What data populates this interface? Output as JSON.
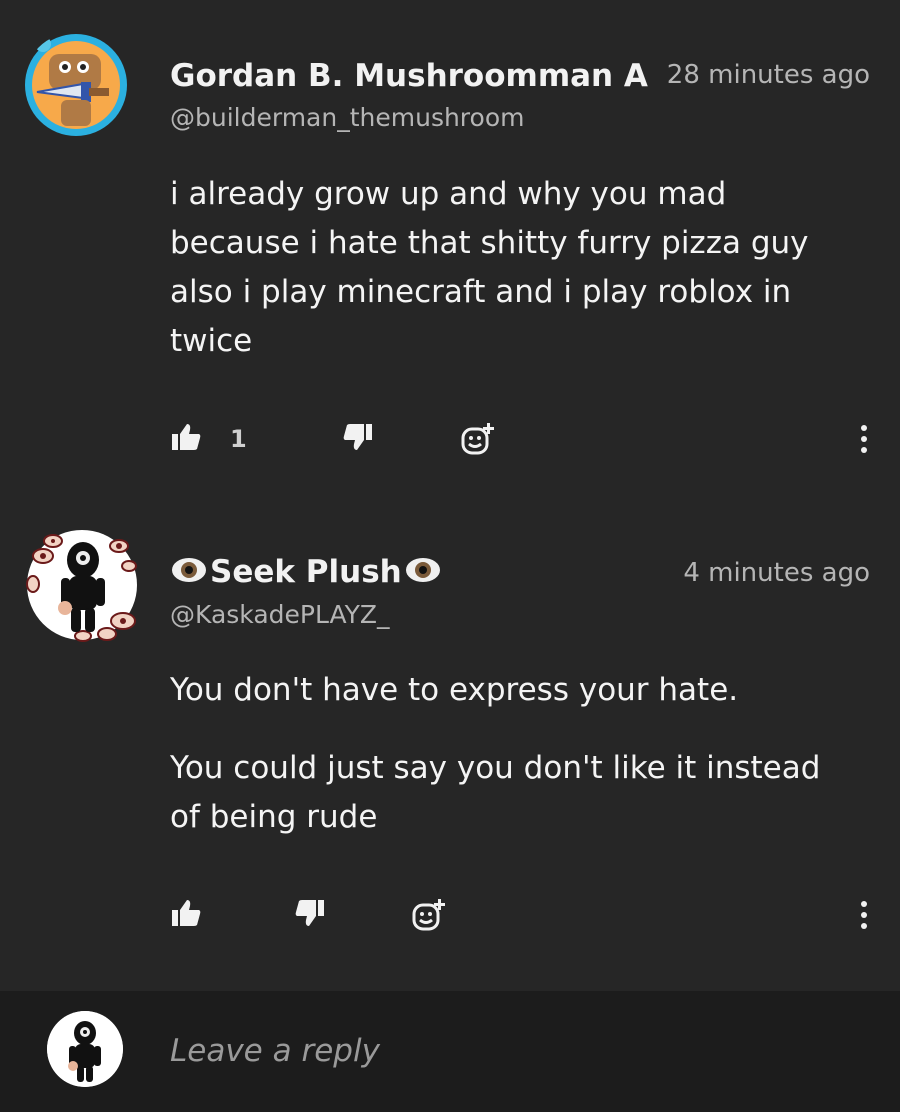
{
  "comments": [
    {
      "author": "Gordan B. Mushroomman A",
      "handle": "@builderman_themushroom",
      "time": "28 minutes ago",
      "paragraphs": [
        "i already grow up and why you mad because i hate that shitty furry pizza guy also i play minecraft and i play roblox in twice"
      ],
      "likes": "1",
      "avatar_icon": "mushroom-knight-avatar"
    },
    {
      "author": "Seek Plush",
      "handle": "@KaskadePLAYZ_",
      "time": "4 minutes ago",
      "paragraphs": [
        "You don't have to express your hate.",
        "You could just say you don't like it instead of being rude"
      ],
      "likes": "",
      "avatar_icon": "seek-plush-avatar",
      "name_icons": [
        "eye-icon",
        "eye-icon"
      ]
    }
  ],
  "reply": {
    "placeholder": "Leave a reply"
  },
  "colors": {
    "background": "#262626",
    "reply_bar": "#1c1c1c",
    "muted_text": "#b5b5b5",
    "text": "#f2f2f2"
  }
}
